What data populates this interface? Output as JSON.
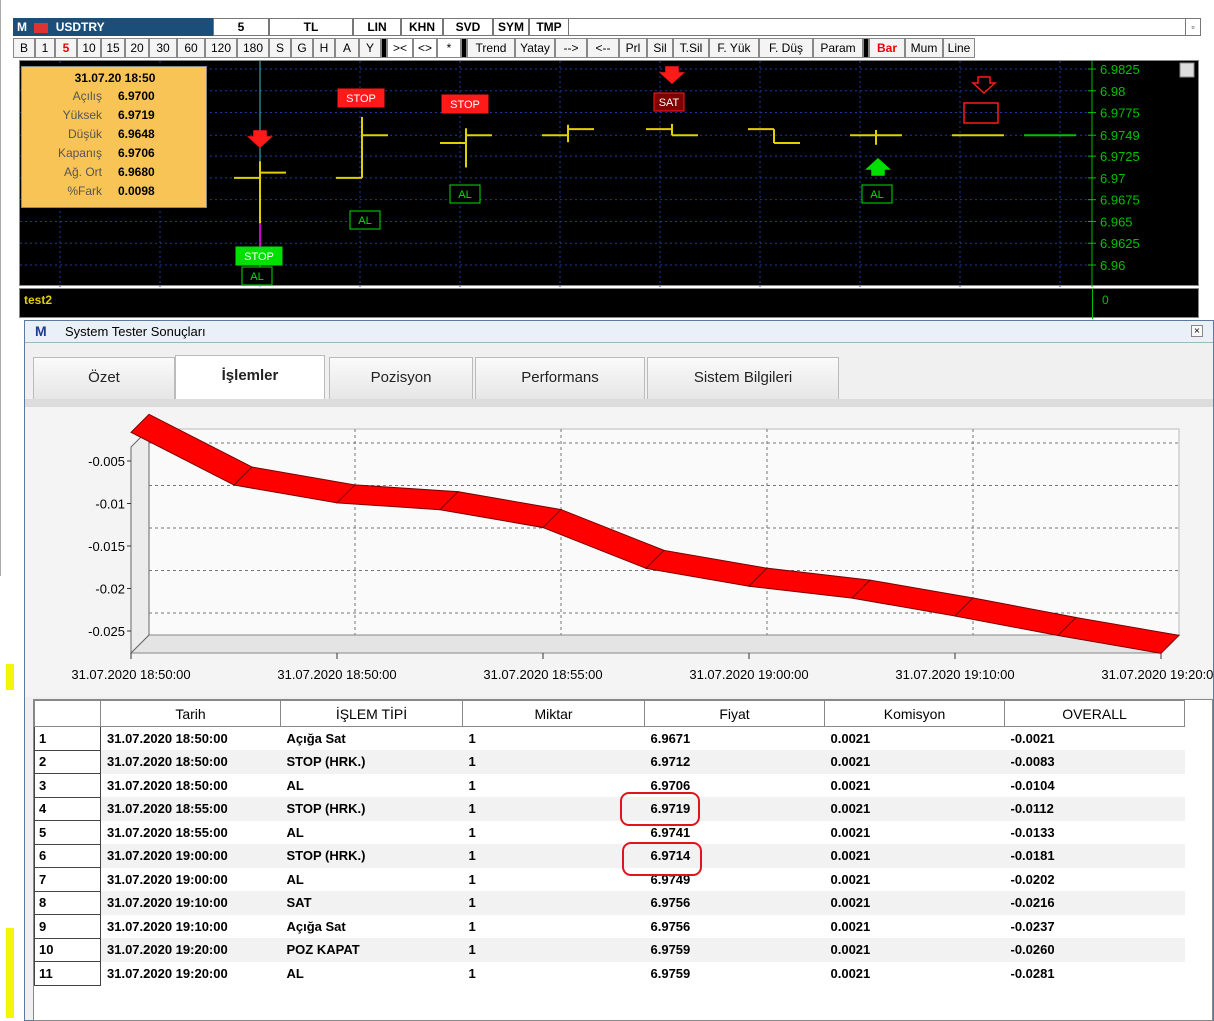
{
  "top_window": {
    "logo": "M",
    "symbol": "USDTRY",
    "period": "5",
    "currency": "TL",
    "title_buttons": [
      "LIN",
      "KHN",
      "SVD",
      "SYM",
      "TMP"
    ],
    "toolbar_buttons": [
      "B",
      "1",
      "5",
      "10",
      "15",
      "20",
      "30",
      "60",
      "120",
      "180",
      "S",
      "G",
      "H",
      "A",
      "Y",
      "><",
      "<>",
      "*",
      "Trend",
      "Yatay",
      "-->",
      "<--",
      "Prl",
      "Sil",
      "T.Sil",
      "F. Yük",
      "F. Düş",
      "Param",
      "Bar",
      "Mum",
      "Line"
    ],
    "toolbar_active": "5",
    "toolbar_red": "Bar",
    "price_axis": [
      "6.9825",
      "6.98",
      "6.9775",
      "6.9749",
      "6.9725",
      "6.97",
      "6.9675",
      "6.965",
      "6.9625",
      "6.96"
    ],
    "info": {
      "datetime": "31.07.20 18:50",
      "rows": [
        {
          "label": "Açılış",
          "value": "6.9700"
        },
        {
          "label": "Yüksek",
          "value": "6.9719"
        },
        {
          "label": "Düşük",
          "value": "6.9648"
        },
        {
          "label": "Kapanış",
          "value": "6.9706"
        },
        {
          "label": "Ağ. Ort",
          "value": "6.9680"
        },
        {
          "label": "%Fark",
          "value": "0.0098"
        }
      ]
    },
    "signals": {
      "stop": "STOP",
      "al": "AL",
      "sat": "SAT"
    },
    "indicator_name": "test2",
    "indicator_axis": "0",
    "colors": {
      "up": "#e0d000",
      "signal_red": "#ff1a1a",
      "signal_green": "#00e000",
      "cursor": "#40c0c0"
    }
  },
  "tester": {
    "logo": "M",
    "title": "System Tester Sonuçları",
    "tabs": [
      "Özet",
      "İşlemler",
      "Pozisyon",
      "Performans",
      "Sistem Bilgileri"
    ],
    "active_tab": "İşlemler",
    "graph": {
      "y_ticks": [
        "-0.005",
        "-0.01",
        "-0.015",
        "-0.02",
        "-0.025"
      ],
      "x_ticks": [
        "31.07.2020 18:50:00",
        "31.07.2020 18:50:00",
        "31.07.2020 18:55:00",
        "31.07.2020 19:00:00",
        "31.07.2020 19:10:00",
        "31.07.2020 19:20:00"
      ]
    },
    "table": {
      "columns": [
        "",
        "Tarih",
        "İŞLEM TİPİ",
        "Miktar",
        "Fiyat",
        "Komisyon",
        "OVERALL"
      ],
      "rows": [
        [
          "1",
          "31.07.2020 18:50:00",
          "Açığa Sat",
          "1",
          "6.9671",
          "0.0021",
          "-0.0021"
        ],
        [
          "2",
          "31.07.2020 18:50:00",
          "STOP (HRK.)",
          "1",
          "6.9712",
          "0.0021",
          "-0.0083"
        ],
        [
          "3",
          "31.07.2020 18:50:00",
          "AL",
          "1",
          "6.9706",
          "0.0021",
          "-0.0104"
        ],
        [
          "4",
          "31.07.2020 18:55:00",
          "STOP (HRK.)",
          "1",
          "6.9719",
          "0.0021",
          "-0.0112"
        ],
        [
          "5",
          "31.07.2020 18:55:00",
          "AL",
          "1",
          "6.9741",
          "0.0021",
          "-0.0133"
        ],
        [
          "6",
          "31.07.2020 19:00:00",
          "STOP (HRK.)",
          "1",
          "6.9714",
          "0.0021",
          "-0.0181"
        ],
        [
          "7",
          "31.07.2020 19:00:00",
          "AL",
          "1",
          "6.9749",
          "0.0021",
          "-0.0202"
        ],
        [
          "8",
          "31.07.2020 19:10:00",
          "SAT",
          "1",
          "6.9756",
          "0.0021",
          "-0.0216"
        ],
        [
          "9",
          "31.07.2020 19:10:00",
          "Açığa Sat",
          "1",
          "6.9756",
          "0.0021",
          "-0.0237"
        ],
        [
          "10",
          "31.07.2020 19:20:00",
          "POZ KAPAT",
          "1",
          "6.9759",
          "0.0021",
          "-0.0260"
        ],
        [
          "11",
          "31.07.2020 19:20:00",
          "AL",
          "1",
          "6.9759",
          "0.0021",
          "-0.0281"
        ]
      ],
      "highlighted_prices": [
        "6.9719",
        "6.9714"
      ]
    },
    "colors": {
      "ribbon": "#ff0000",
      "ribbon_edge": "#7a0000",
      "highlight": "#e0141e"
    }
  },
  "chart_data": {
    "type": "area",
    "title": "",
    "xlabel": "",
    "ylabel": "",
    "x": [
      "31.07.2020 18:50:00",
      "31.07.2020 18:50:00",
      "31.07.2020 18:50:00",
      "31.07.2020 18:55:00",
      "31.07.2020 18:55:00",
      "31.07.2020 19:00:00",
      "31.07.2020 19:00:00",
      "31.07.2020 19:10:00",
      "31.07.2020 19:10:00",
      "31.07.2020 19:20:00",
      "31.07.2020 19:20:00"
    ],
    "series": [
      {
        "values": [
          -0.0021,
          -0.0083,
          -0.0104,
          -0.0112,
          -0.0133,
          -0.0181,
          -0.0202,
          -0.0216,
          -0.0237,
          -0.026,
          -0.0281
        ]
      }
    ],
    "ylim": [
      -0.0281,
      -0.0021
    ],
    "grid": true
  }
}
